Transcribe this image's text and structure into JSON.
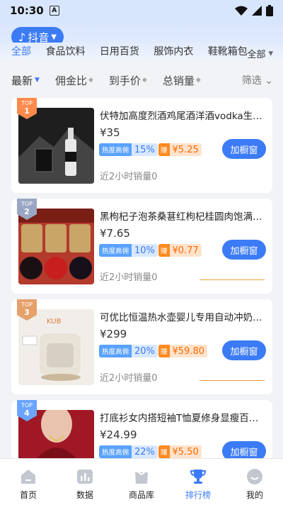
{
  "status": {
    "time": "10:30",
    "sim": "A"
  },
  "header": {
    "platform": "抖音"
  },
  "categories": {
    "items": [
      "全部",
      "食品饮料",
      "日用百货",
      "服饰内衣",
      "鞋靴箱包"
    ],
    "more": "全部"
  },
  "sort": {
    "latest": "最新",
    "commission": "佣金比",
    "arrival_price": "到手价",
    "total_sales": "总销量",
    "filter": "筛选"
  },
  "products": [
    {
      "rank_label": "TOP",
      "rank": "1",
      "title": "伏特加高度烈酒鸡尾酒洋酒vodka生命之水",
      "price": "¥35",
      "hot_label": "热度高佣",
      "hot_value": "15%",
      "earn_label": "赚",
      "earn_value": "¥5.25",
      "button": "加橱窗",
      "sales": "近2小时销量0"
    },
    {
      "rank_label": "TOP",
      "rank": "2",
      "title": "黑枸杞子泡茶桑葚红枸杞桂圆肉饱满晾晒",
      "price": "¥7.65",
      "hot_label": "热度高佣",
      "hot_value": "10%",
      "earn_label": "赚",
      "earn_value": "¥0.77",
      "button": "加橱窗",
      "sales": "近2小时销量0"
    },
    {
      "rank_label": "TOP",
      "rank": "3",
      "title": "可优比恒温热水壶婴儿专用自动冲奶机台式",
      "price": "¥299",
      "hot_label": "热度高佣",
      "hot_value": "20%",
      "earn_label": "赚",
      "earn_value": "¥59.80",
      "button": "加橱窗",
      "sales": "近2小时销量0"
    },
    {
      "rank_label": "TOP",
      "rank": "4",
      "title": "打底衫女内搭短袖T恤夏修身显瘦百搭女装",
      "price": "¥24.99",
      "hot_label": "热度高佣",
      "hot_value": "22%",
      "earn_label": "赚",
      "earn_value": "¥5.50",
      "button": "加橱窗",
      "sales": ""
    }
  ],
  "tabs": [
    {
      "label": "首页",
      "icon": "home-icon"
    },
    {
      "label": "数据",
      "icon": "bar-chart-icon"
    },
    {
      "label": "商品库",
      "icon": "bag-icon"
    },
    {
      "label": "排行榜",
      "icon": "trophy-icon"
    },
    {
      "label": "我的",
      "icon": "smile-icon"
    }
  ],
  "colors": {
    "primary": "#3c7bf6",
    "earn": "#ff6a00",
    "hot": "#5aa2ff"
  }
}
